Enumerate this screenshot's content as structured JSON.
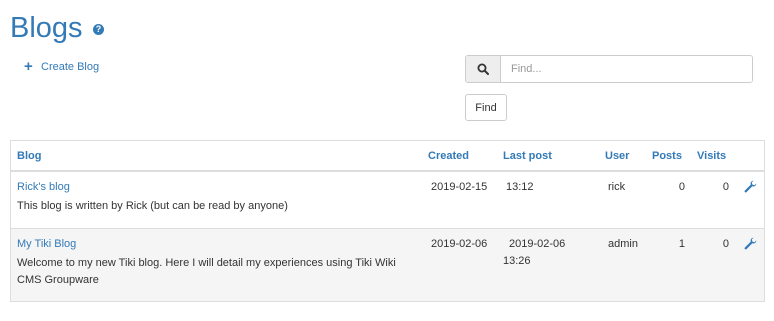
{
  "header": {
    "title": "Blogs",
    "help_glyph": "?",
    "help_icon": "question-circle-icon"
  },
  "actions": {
    "create_blog_label": "Create Blog",
    "create_icon": "plus-icon"
  },
  "search": {
    "placeholder": "Find...",
    "value": "",
    "icon": "search-icon",
    "button_label": "Find"
  },
  "table": {
    "columns": {
      "blog": "Blog",
      "created": "Created",
      "last_post": "Last post",
      "user": "User",
      "posts": "Posts",
      "visits": "Visits"
    },
    "rows": [
      {
        "title": "Rick's blog",
        "description": "This blog is written by Rick (but can be read by anyone)",
        "created": "2019-02-15",
        "last_post": "13:12",
        "user": "rick",
        "posts": "0",
        "visits": "0",
        "action_icon": "wrench-icon"
      },
      {
        "title": "My Tiki Blog",
        "description": "Welcome to my new Tiki blog. Here I will detail my experiences using Tiki Wiki CMS Groupware",
        "created": "2019-02-06",
        "last_post_line1": "2019-02-06",
        "last_post_line2": "13:26",
        "user": "admin",
        "posts": "1",
        "visits": "0",
        "action_icon": "wrench-icon"
      }
    ]
  },
  "colors": {
    "accent": "#337ab7",
    "border": "#dddddd",
    "row_alt": "#f5f5f5",
    "text": "#333333"
  }
}
